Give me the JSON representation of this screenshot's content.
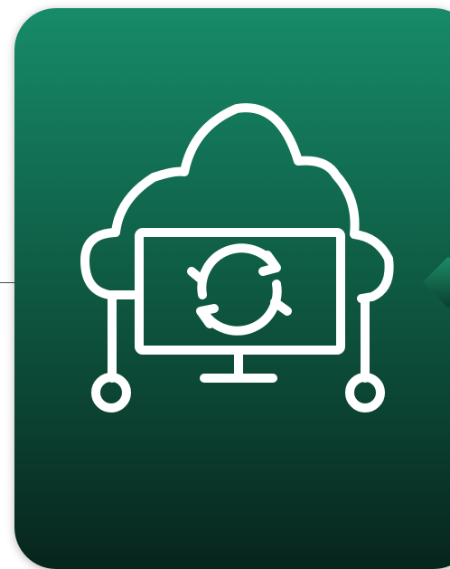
{
  "card": {
    "icon": "cloud-computer-sync-icon",
    "colors": {
      "gradient_top": "#178b68",
      "gradient_mid": "#0f5e46",
      "gradient_bottom": "#07251c",
      "icon_stroke": "#ffffff"
    }
  }
}
